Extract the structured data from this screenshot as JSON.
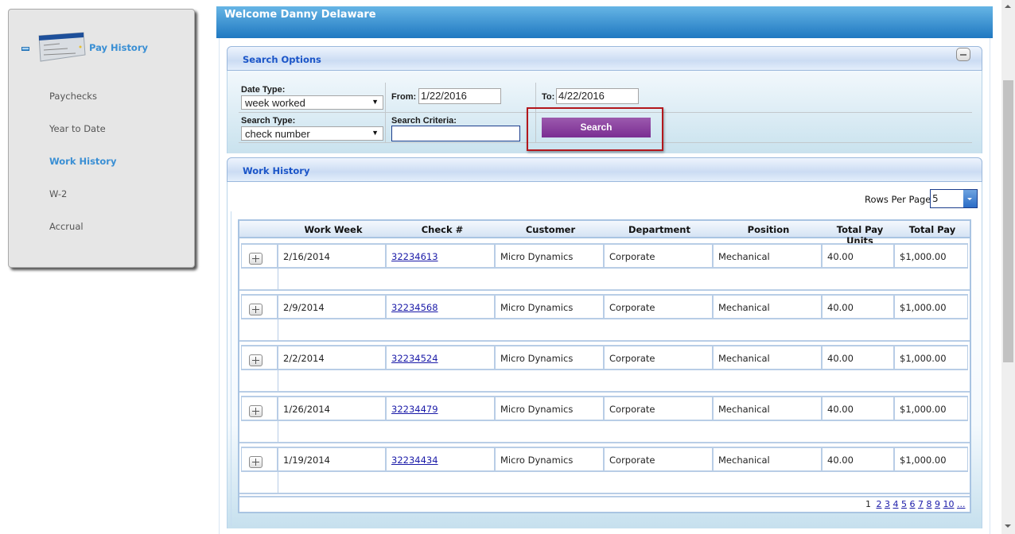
{
  "sidebar": {
    "title": "Pay History",
    "header_icon": "paycheck-icon",
    "items": [
      {
        "label": "Paychecks",
        "active": false
      },
      {
        "label": "Year to Date",
        "active": false
      },
      {
        "label": "Work History",
        "active": true
      },
      {
        "label": "W-2",
        "active": false
      },
      {
        "label": "Accrual",
        "active": false
      }
    ]
  },
  "header": {
    "welcome": "Welcome Danny Delaware"
  },
  "search_options": {
    "title": "Search Options",
    "collapse_icon": "minus-icon",
    "date_type": {
      "label": "Date Type:",
      "value": "week worked"
    },
    "search_type": {
      "label": "Search Type:",
      "value": "check number"
    },
    "from": {
      "label": "From:",
      "value": "1/22/2016"
    },
    "to": {
      "label": "To:",
      "value": "4/22/2016"
    },
    "criteria": {
      "label": "Search Criteria:",
      "value": ""
    },
    "search_button": "Search",
    "colors": {
      "search_button": "#7f3396",
      "highlight": "#b3171c"
    }
  },
  "work_history": {
    "title": "Work History",
    "rows_per_page": {
      "label": "Rows Per Page",
      "value": "5"
    },
    "columns": [
      "Work Week",
      "Check #",
      "Customer",
      "Department",
      "Position",
      "Total Pay Units",
      "Total Pay"
    ],
    "rows": [
      {
        "work_week": "2/16/2014",
        "check": "32234613",
        "customer": "Micro Dynamics",
        "department": "Corporate",
        "position": "Mechanical",
        "units": "40.00",
        "pay": "$1,000.00"
      },
      {
        "work_week": "2/9/2014",
        "check": "32234568",
        "customer": "Micro Dynamics",
        "department": "Corporate",
        "position": "Mechanical",
        "units": "40.00",
        "pay": "$1,000.00"
      },
      {
        "work_week": "2/2/2014",
        "check": "32234524",
        "customer": "Micro Dynamics",
        "department": "Corporate",
        "position": "Mechanical",
        "units": "40.00",
        "pay": "$1,000.00"
      },
      {
        "work_week": "1/26/2014",
        "check": "32234479",
        "customer": "Micro Dynamics",
        "department": "Corporate",
        "position": "Mechanical",
        "units": "40.00",
        "pay": "$1,000.00"
      },
      {
        "work_week": "1/19/2014",
        "check": "32234434",
        "customer": "Micro Dynamics",
        "department": "Corporate",
        "position": "Mechanical",
        "units": "40.00",
        "pay": "$1,000.00"
      }
    ],
    "pager": {
      "current": "1",
      "pages": [
        "2",
        "3",
        "4",
        "5",
        "6",
        "7",
        "8",
        "9",
        "10",
        "..."
      ]
    }
  }
}
